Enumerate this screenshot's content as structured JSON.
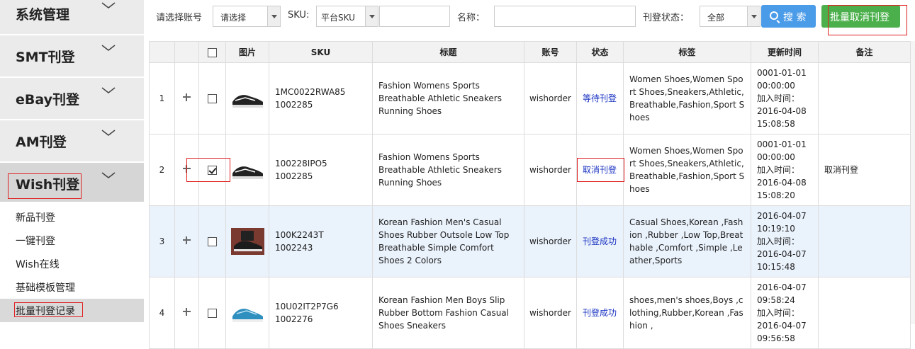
{
  "sidebar": {
    "sections": [
      {
        "label": "系统管理"
      },
      {
        "label": "SMT刊登"
      },
      {
        "label": "eBay刊登"
      },
      {
        "label": "AM刊登"
      },
      {
        "label": "Wish刊登"
      }
    ],
    "sub_items": [
      {
        "label": "新品刊登"
      },
      {
        "label": "一键刊登"
      },
      {
        "label": "Wish在线"
      },
      {
        "label": "基础模板管理"
      },
      {
        "label": "批量刊登记录"
      }
    ]
  },
  "toolbar": {
    "account_label": "请选择账号",
    "account_value": "请选择",
    "sku_label": "SKU:",
    "sku_type_value": "平台SKU",
    "sku_input": "",
    "name_label": "名称：",
    "name_input": "",
    "status_label": "刊登状态：",
    "status_value": "全部",
    "search_label": "搜 索",
    "batch_cancel_label": "批量取消刊登"
  },
  "table": {
    "headers": [
      "",
      "",
      "",
      "图片",
      "SKU",
      "标题",
      "账号",
      "状态",
      "标签",
      "更新时间",
      "备注"
    ],
    "rows": [
      {
        "index": "1",
        "checked": false,
        "sku1": "1MC0022RWA85",
        "sku2": "1002285",
        "title": "Fashion Womens Sports Breathable Athletic Sneakers Running Shoes",
        "account": "wishorder",
        "status": "等待刊登",
        "tags": "Women Shoes,Women Sport Shoes,Sneakers,Athletic,Breathable,Fashion,Sport Shoes",
        "updated": "0001-01-01 00:00:00",
        "added_label": "加入时间：",
        "added": "2016-04-08 15:08:58",
        "note": ""
      },
      {
        "index": "2",
        "checked": true,
        "sku1": "100228IPO5",
        "sku2": "1002285",
        "title": "Fashion Womens Sports Breathable Athletic Sneakers Running Shoes",
        "account": "wishorder",
        "status": "取消刊登",
        "tags": "Women Shoes,Women Sport Shoes,Sneakers,Athletic,Breathable,Fashion,Sport Shoes",
        "updated": "0001-01-01 00:00:00",
        "added_label": "加入时间：",
        "added": "2016-04-08 15:08:20",
        "note": "取消刊登"
      },
      {
        "index": "3",
        "checked": false,
        "sku1": "100K2243T",
        "sku2": "1002243",
        "title": "Korean Fashion Men's Casual Shoes Rubber Outsole Low Top Breathable Simple Comfort Shoes 2 Colors",
        "account": "wishorder",
        "status": "刊登成功",
        "tags": "Casual Shoes,Korean ,Fashion ,Rubber ,Low Top,Breathable ,Comfort ,Simple ,Leather,Sports",
        "updated": "2016-04-07 10:19:10",
        "added_label": "加入时间：",
        "added": "2016-04-07 10:15:48",
        "note": ""
      },
      {
        "index": "4",
        "checked": false,
        "sku1": "10U02IT2P7G6",
        "sku2": "1002276",
        "title": "Korean Fashion Men Boys Slip Rubber Bottom Fashion Casual Shoes Sneakers",
        "account": "wishorder",
        "status": "刊登成功",
        "tags": "shoes,men's shoes,Boys ,clothing,Rubber,Korean ,Fashion ,",
        "updated": "2016-04-07 09:58:24",
        "added_label": "加入时间：",
        "added": "2016-04-07 09:56:58",
        "note": ""
      }
    ]
  },
  "colors": {
    "search_button": "#4a9be8",
    "batch_button": "#4bb04b",
    "status_link": "#1a33c2",
    "highlight_box": "#e02020",
    "selected_row": "#eaf2fc"
  }
}
